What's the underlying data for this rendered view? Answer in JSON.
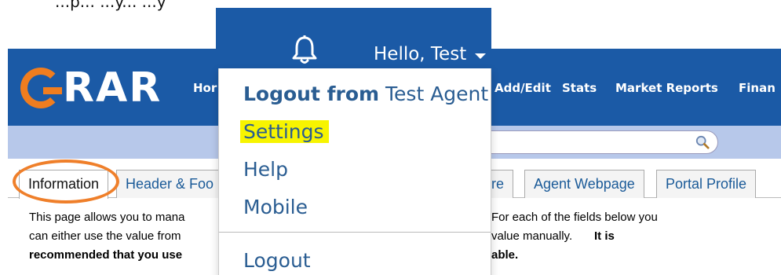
{
  "instruction_text": "...p... ...y... ...y",
  "header": {
    "logo_text": "RAR",
    "nav": [
      "Hor",
      "Add/Edit",
      "Stats",
      "Market Reports",
      "Finan"
    ]
  },
  "tabs": [
    "Information",
    "Header & Foo",
    "ure",
    "Agent Webpage",
    "Portal Profile"
  ],
  "description": {
    "line1a": "This page allows you to mana",
    "line1b": "For each of the fields below you",
    "line2a": "can either use the value from",
    "line2b": "value manually.",
    "line2c": "It is",
    "line3a": "recommended that you use",
    "line3b": "able."
  },
  "user_menu": {
    "greeting": "Hello, Test",
    "logout_from_prefix": "Logout from",
    "logout_from_name": "Test Agent",
    "settings": "Settings",
    "help": "Help",
    "mobile": "Mobile",
    "logout": "Logout"
  },
  "colors": {
    "header_blue": "#1b5aa6",
    "logo_orange": "#f07d1f",
    "highlight_yellow": "#f7f400",
    "menu_text": "#2a5d92"
  }
}
